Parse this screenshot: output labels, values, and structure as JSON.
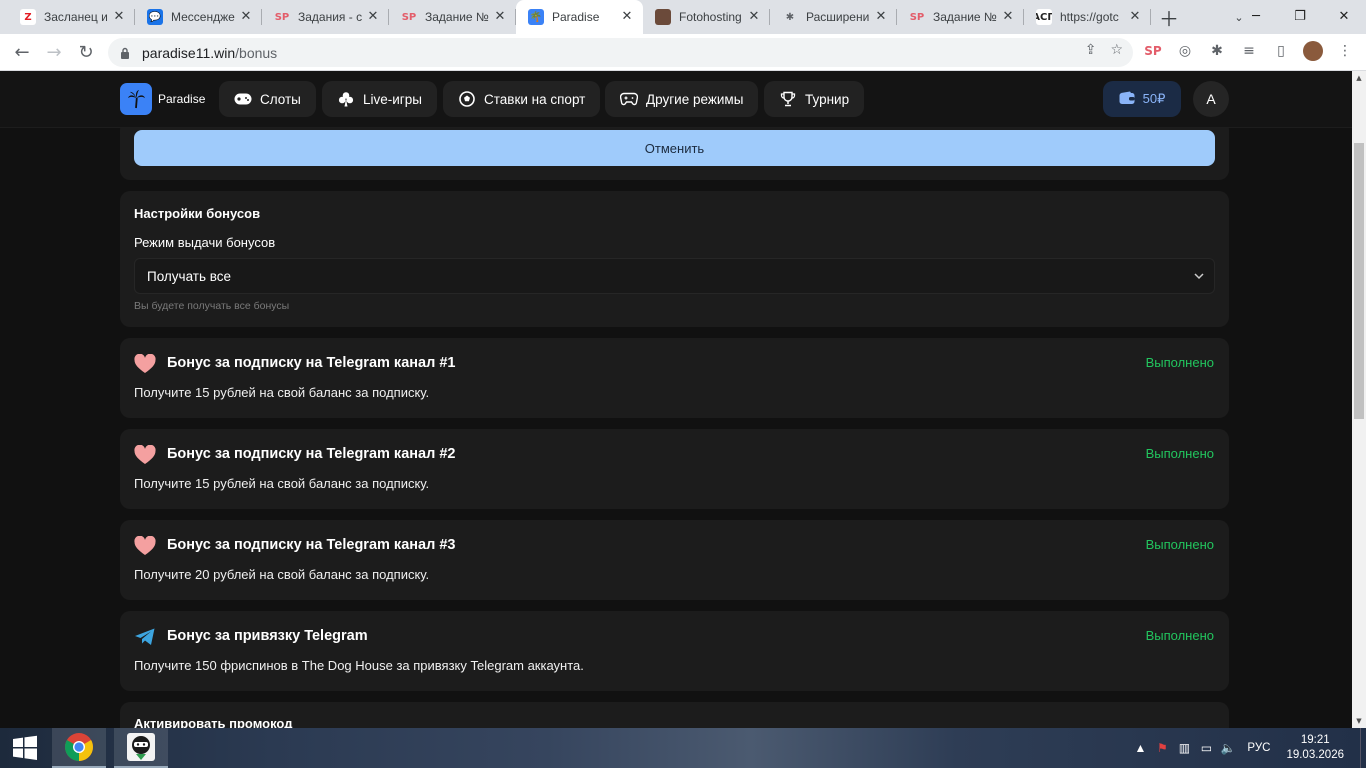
{
  "browser": {
    "tabs": [
      {
        "title": "Засланец и",
        "favicon_text": "Z",
        "favicon_color": "#ffffff",
        "favicon_fg": "#e31b23",
        "active": false
      },
      {
        "title": "Мессендже",
        "favicon_text": "💬",
        "favicon_color": "#1a73e8",
        "favicon_fg": "#ffffff",
        "active": false
      },
      {
        "title": "Задания - с",
        "favicon_text": "SP",
        "favicon_color": "#dee1e6",
        "favicon_fg": "#e35d6a",
        "active": false
      },
      {
        "title": "Задание №",
        "favicon_text": "SP",
        "favicon_color": "#dee1e6",
        "favicon_fg": "#e35d6a",
        "active": false
      },
      {
        "title": "Paradise",
        "favicon_text": "🌴",
        "favicon_color": "#3b82f6",
        "favicon_fg": "#ffffff",
        "active": true
      },
      {
        "title": "Fotohosting",
        "favicon_text": "",
        "favicon_color": "#6b4a3a",
        "favicon_fg": "#ffffff",
        "active": false
      },
      {
        "title": "Расширени",
        "favicon_text": "✱",
        "favicon_color": "#dee1e6",
        "favicon_fg": "#5f6368",
        "active": false
      },
      {
        "title": "Задание №",
        "favicon_text": "SP",
        "favicon_color": "#dee1e6",
        "favicon_fg": "#e35d6a",
        "active": false
      },
      {
        "title": "https://gotc",
        "favicon_text": "АСП",
        "favicon_color": "#ffffff",
        "favicon_fg": "#222222",
        "active": false
      }
    ],
    "url_host": "paradise11.win",
    "url_path": "/bonus"
  },
  "site": {
    "logo_name": "Paradise",
    "nav": [
      {
        "label": "Слоты",
        "icon": "gamepad-icon"
      },
      {
        "label": "Live-игры",
        "icon": "club-icon"
      },
      {
        "label": "Ставки на спорт",
        "icon": "soccer-ball-icon"
      },
      {
        "label": "Другие режимы",
        "icon": "controller-icon"
      },
      {
        "label": "Турнир",
        "icon": "trophy-icon"
      }
    ],
    "balance": "50₽",
    "avatar_letter": "A"
  },
  "page": {
    "cancel_label": "Отменить",
    "settings": {
      "title": "Настройки бонусов",
      "mode_label": "Режим выдачи бонусов",
      "mode_value": "Получать все",
      "hint": "Вы будете получать все бонусы"
    },
    "bonuses": [
      {
        "icon": "heart-icon",
        "title": "Бонус за подписку на Telegram канал #1",
        "status": "Выполнено",
        "desc": "Получите 15 рублей на свой баланс за подписку."
      },
      {
        "icon": "heart-icon",
        "title": "Бонус за подписку на Telegram канал #2",
        "status": "Выполнено",
        "desc": "Получите 15 рублей на свой баланс за подписку."
      },
      {
        "icon": "heart-icon",
        "title": "Бонус за подписку на Telegram канал #3",
        "status": "Выполнено",
        "desc": "Получите 20 рублей на свой баланс за подписку."
      },
      {
        "icon": "telegram-icon",
        "title": "Бонус за привязку Telegram",
        "status": "Выполнено",
        "desc": "Получите 150 фриспинов в The Dog House за привязку Telegram аккаунта."
      }
    ],
    "promo_title": "Активировать промокод"
  },
  "colors": {
    "accent": "#3b82f6",
    "success": "#22c55e",
    "heart": "#f4a0a0",
    "telegram": "#3da5e0"
  },
  "taskbar": {
    "lang": "РУС",
    "time": "19:21",
    "date": "19.03.2026"
  }
}
